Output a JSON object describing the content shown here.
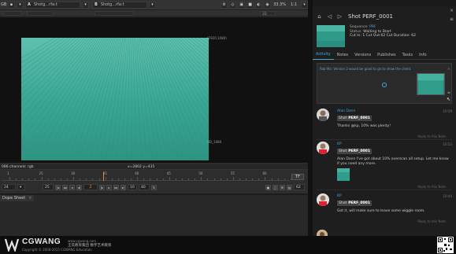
{
  "topbar": {
    "left_label": "GB",
    "input_a": {
      "letter": "A",
      "value": "Shotg...rfa:t"
    },
    "input_b": {
      "letter": "B",
      "value": "Shotg...rfa:t"
    },
    "zoom": "33.3%",
    "ratio": "1:1",
    "view_mode": "2D"
  },
  "viewer": {
    "format_top": "(1920,1080)",
    "format_bottom": "HD_1080",
    "channels_text": "086 channels: rgb",
    "coords_text": "x=2802 y=435"
  },
  "timeline": {
    "ticks": [
      "1",
      "25",
      "30",
      "35",
      "40",
      "45",
      "50",
      "55",
      "60"
    ],
    "in_point": "25",
    "out_point": "40",
    "frame": "2",
    "fps": "24",
    "step": "10",
    "end_frame": "62",
    "mode_label": "TF"
  },
  "dopesheet": {
    "tab_label": "Dope Sheet"
  },
  "panel": {
    "title": "Shot PERF_0001",
    "entity": {
      "sequence_label": "Sequence:",
      "sequence_value": "PRF",
      "status_label": "Status:",
      "status_value": "Waiting to Start",
      "cut_line": "Cut In: 1 Cut Out:62 Cut Duration: 62"
    },
    "tabs": [
      "Activity",
      "Notes",
      "Versions",
      "Publishes",
      "Tasks",
      "Info"
    ],
    "active_tab": "Activity",
    "new_note": {
      "placeholder": "Rob Ma: Version 2 would be good to go to show the client."
    },
    "notes": [
      {
        "author": "Alan Dann",
        "date": "10:59",
        "chip_prefix": "Shot",
        "chip_entity": "PERF_0001",
        "body": "Thanks @kp, 10% was plenty!",
        "reply": "Reply to this Note"
      },
      {
        "author": "KP",
        "date": "10:53",
        "chip_prefix": "Shot",
        "chip_entity": "PERF_0001",
        "body": "Alan Dann I've got about 10% overscan all setup.  Let me know if you need any more.",
        "reply": "Reply to this Note"
      },
      {
        "author": "KP",
        "date": "10:44",
        "chip_prefix": "Shot",
        "chip_entity": "PERF_0001",
        "body": "Got it, will make sure to leave some wiggle room.",
        "reply": "Reply to this Note"
      }
    ]
  },
  "brand": {
    "name": "CGWANG",
    "url": "www.cgwang.com",
    "cn_name": "王氏教育集团",
    "tagline": "数字艺术教育",
    "copyright": "Copyright © 2008-2015 CGWANG Education"
  },
  "colors": {
    "accent": "#3fa9e0",
    "playhead": "#d98c2b",
    "frame_teal": "#3aa896"
  }
}
